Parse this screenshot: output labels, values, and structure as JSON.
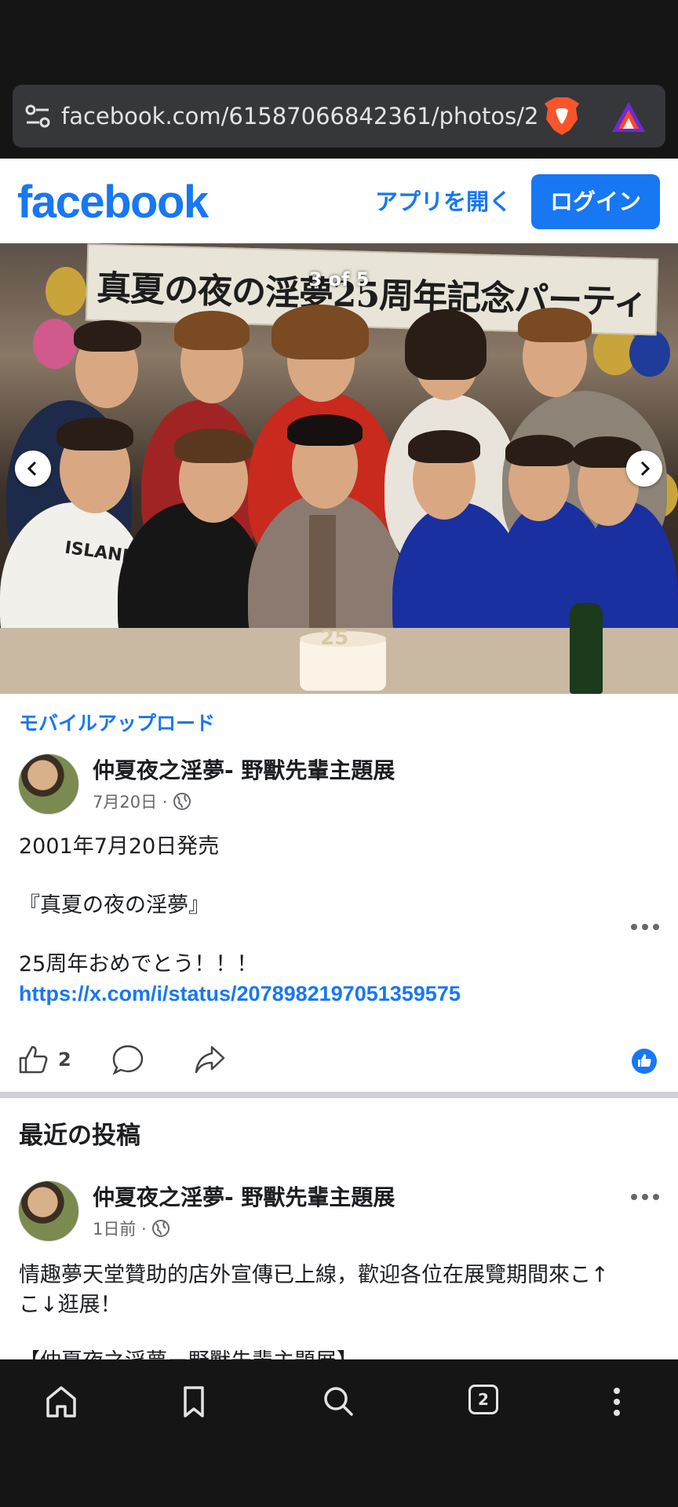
{
  "browser": {
    "url": "facebook.com/61587066842361/photos/2",
    "tab_count": "2"
  },
  "header": {
    "logo": "facebook",
    "open_app": "アプリを開く",
    "login": "ログイン"
  },
  "photo": {
    "counter": "3 of 5",
    "banner_text": "真夏の夜の淫夢25周年記念パーティ",
    "shirt_text": "ISLANDER",
    "cake_number": "25"
  },
  "mobile_upload": "モバイルアップロード",
  "post1": {
    "author": "仲夏夜之淫夢- 野獸先輩主題展",
    "date": "7月20日 ·",
    "lines": [
      "2001年7月20日発売",
      "『真夏の夜の淫夢』",
      "25周年おめでとう！！！"
    ],
    "link": "https://x.com/i/status/2078982197051359575",
    "like_count": "2"
  },
  "recent_posts": {
    "title": "最近の投稿",
    "post": {
      "author": "仲夏夜之淫夢- 野獸先輩主題展",
      "date": "1日前 ·",
      "lines": [
        "情趣夢天堂贊助的店外宣傳已上線，歡迎各位在展覽期間來こ↑",
        "こ↓逛展！",
        "【仲夏夜之淫夢－野獸先輩主題展】"
      ]
    }
  },
  "colors": {
    "accent": "#1877f2",
    "text": "#1c1e21",
    "meta": "#65676b",
    "chrome": "#151515"
  }
}
